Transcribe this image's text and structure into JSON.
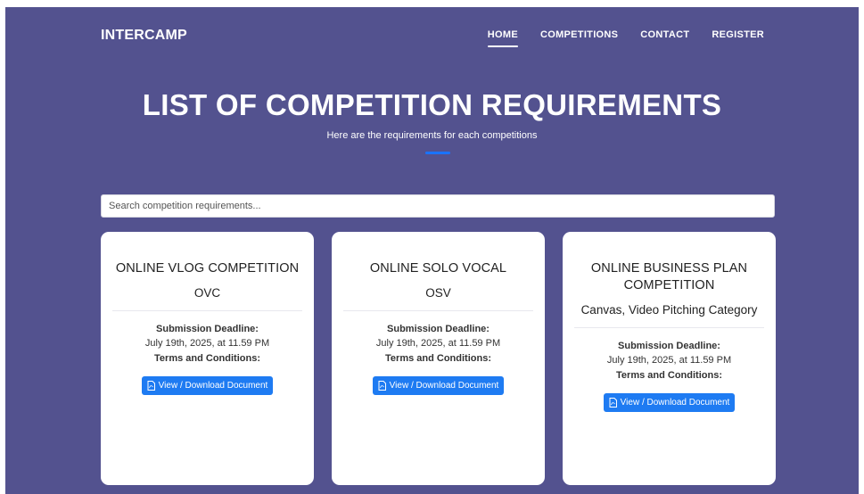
{
  "header": {
    "brand": "INTERCAMP",
    "nav": [
      {
        "label": "HOME",
        "active": true
      },
      {
        "label": "COMPETITIONS",
        "active": false
      },
      {
        "label": "CONTACT",
        "active": false
      },
      {
        "label": "REGISTER",
        "active": false
      }
    ]
  },
  "hero": {
    "title": "LIST OF COMPETITION REQUIREMENTS",
    "subtitle": "Here are the requirements for each competitions",
    "accent_color": "#1a73ff"
  },
  "search": {
    "placeholder": "Search competition requirements...",
    "value": ""
  },
  "colors": {
    "background": "#53528f",
    "button": "#1e7bf2"
  },
  "cards": [
    {
      "title": "ONLINE VLOG COMPETITION",
      "code": "OVC",
      "deadline_label": "Submission Deadline:",
      "deadline": "July 19th, 2025, at 11.59 PM",
      "terms_label": "Terms and Conditions:",
      "button_label": "View / Download Document",
      "button_icon": "file-pdf-icon"
    },
    {
      "title": "ONLINE SOLO VOCAL",
      "code": "OSV",
      "deadline_label": "Submission Deadline:",
      "deadline": "July 19th, 2025, at 11.59 PM",
      "terms_label": "Terms and Conditions:",
      "button_label": "View / Download Document",
      "button_icon": "file-pdf-icon"
    },
    {
      "title": "ONLINE BUSINESS PLAN COMPETITION",
      "code": "Canvas, Video Pitching Category",
      "deadline_label": "Submission Deadline:",
      "deadline": "July 19th, 2025, at 11.59 PM",
      "terms_label": "Terms and Conditions:",
      "button_label": "View / Download Document",
      "button_icon": "file-pdf-icon"
    }
  ]
}
